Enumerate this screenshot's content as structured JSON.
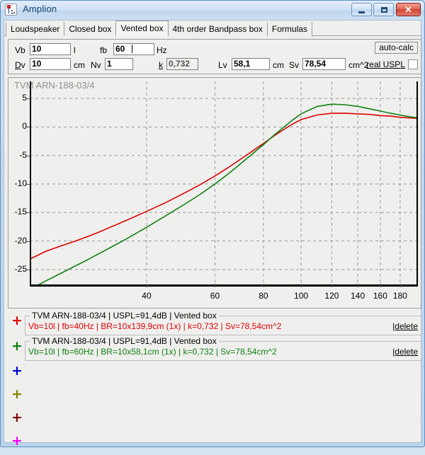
{
  "window": {
    "title": "Amplion",
    "icon": "app-marker-icon",
    "controls": {
      "minimize": "minimize-button",
      "maximize": "maximize-button",
      "close_glyph": "✕"
    }
  },
  "tabs": [
    {
      "label": "Loudspeaker",
      "selected": false
    },
    {
      "label": "Closed box",
      "selected": false
    },
    {
      "label": "Vented box",
      "selected": true
    },
    {
      "label": "4th order Bandpass box",
      "selected": false
    },
    {
      "label": "Formulas",
      "selected": false
    }
  ],
  "parameters": {
    "vb": {
      "label": "Vb",
      "value": "10",
      "unit": "l"
    },
    "fb": {
      "label": "fb",
      "value": "60",
      "unit": "Hz",
      "focused": true
    },
    "dv": {
      "label": "Dv",
      "accel": "D",
      "rest": "v",
      "value": "10",
      "unit": "cm"
    },
    "nv": {
      "label": "Nv",
      "value": "1",
      "unit": ""
    },
    "k": {
      "label": "k",
      "value": "0,732",
      "readonly": true
    },
    "lv": {
      "label": "Lv",
      "value": "58,1",
      "unit": "cm"
    },
    "sv": {
      "label": "Sv",
      "value": "78,54",
      "unit": "cm^2"
    },
    "auto_calc_label": "auto-calc",
    "real_uspl_label": "real USPL",
    "real_uspl_checked": false
  },
  "chart_data": {
    "type": "line",
    "title": "TVM ARN-188-03/4",
    "xlabel": "",
    "ylabel": "",
    "xscale": "log",
    "xlim": [
      20,
      200
    ],
    "ylim": [
      -28,
      8
    ],
    "grid": true,
    "legend_position": "below-plot",
    "xticks": [
      40,
      60,
      80,
      100,
      120,
      140,
      160,
      180
    ],
    "yticks": [
      5,
      0,
      -5,
      -10,
      -15,
      -20,
      -25
    ],
    "series": [
      {
        "name": "Vb=10l | fb=40Hz",
        "color": "#e00000",
        "x": [
          20,
          22,
          24,
          26,
          28,
          30,
          33,
          36,
          40,
          45,
          50,
          55,
          60,
          65,
          70,
          75,
          80,
          85,
          90,
          95,
          100,
          110,
          120,
          130,
          140,
          150,
          160,
          170,
          180,
          190,
          200
        ],
        "values": [
          -23.2,
          -21.8,
          -20.9,
          -20.1,
          -19.3,
          -18.5,
          -17.3,
          -16.2,
          -14.8,
          -13.2,
          -11.6,
          -10.1,
          -8.6,
          -7.1,
          -5.6,
          -4.2,
          -2.9,
          -1.6,
          -0.5,
          0.5,
          1.3,
          2.1,
          2.4,
          2.4,
          2.3,
          2.2,
          2.0,
          1.9,
          1.7,
          1.6,
          1.5
        ]
      },
      {
        "name": "Vb=10l | fb=60Hz",
        "color": "#108010",
        "x": [
          20,
          22,
          24,
          26,
          28,
          30,
          33,
          36,
          40,
          45,
          50,
          55,
          60,
          65,
          70,
          75,
          80,
          85,
          90,
          95,
          100,
          110,
          120,
          130,
          140,
          150,
          160,
          170,
          180,
          190,
          200
        ],
        "values": [
          -28.5,
          -27.0,
          -25.7,
          -24.5,
          -23.4,
          -22.3,
          -20.8,
          -19.4,
          -17.6,
          -15.5,
          -13.6,
          -11.8,
          -10.0,
          -8.2,
          -6.4,
          -4.7,
          -3.1,
          -1.5,
          -0.1,
          1.2,
          2.3,
          3.6,
          4.0,
          3.9,
          3.6,
          3.2,
          2.8,
          2.4,
          2.1,
          1.8,
          1.6
        ]
      }
    ]
  },
  "legend_rows": [
    {
      "marker_color": "#e00000",
      "caption": "TVM ARN-188-03/4 | USPL=91,4dB | Vented box",
      "detail": "Vb=10l | fb=40Hz | BR=10x139,9cm (1x) | k=0,732 | Sv=78,54cm^2",
      "delete_label": "delete"
    },
    {
      "marker_color": "#108010",
      "caption": "TVM ARN-188-03/4 | USPL=91,4dB | Vented box",
      "detail": "Vb=10l | fb=60Hz | BR=10x58,1cm (1x) | k=0,732 | Sv=78,54cm^2",
      "delete_label": "delete"
    }
  ],
  "empty_slots": [
    {
      "marker_color": "#0000d0"
    },
    {
      "marker_color": "#808000"
    },
    {
      "marker_color": "#800000"
    },
    {
      "marker_color": "#ff00ff"
    }
  ]
}
